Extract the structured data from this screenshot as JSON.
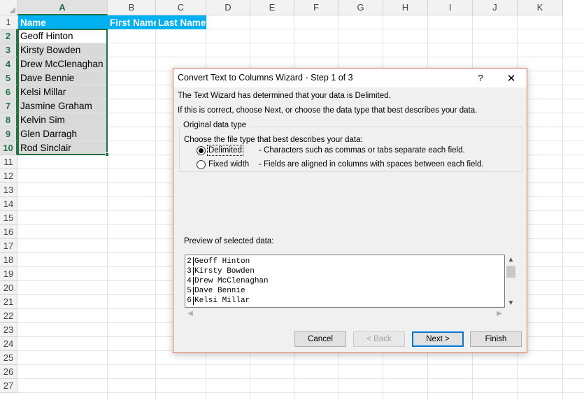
{
  "columns": [
    "A",
    "B",
    "C",
    "D",
    "E",
    "F",
    "G",
    "H",
    "I",
    "J",
    "K"
  ],
  "rows": [
    "1",
    "2",
    "3",
    "4",
    "5",
    "6",
    "7",
    "8",
    "9",
    "10",
    "11",
    "12",
    "13",
    "14",
    "15",
    "16",
    "17",
    "18",
    "19",
    "20",
    "21",
    "22",
    "23",
    "24",
    "25",
    "26",
    "27"
  ],
  "header_cells": {
    "a1": "Name",
    "b1": "First Name",
    "c1": "Last Name"
  },
  "names": [
    "Geoff Hinton",
    "Kirsty Bowden",
    "Drew McClenaghan",
    "Dave Bennie",
    "Kelsi Millar",
    "Jasmine Graham",
    "Kelvin Sim",
    "Glen Darragh",
    "Rod Sinclair"
  ],
  "colors": {
    "header_fill": "#00b0f0",
    "selection_border": "#217346",
    "selected_fill": "#d9d9d9"
  },
  "dialog": {
    "title": "Convert Text to Columns Wizard - Step 1 of 3",
    "help_icon": "?",
    "close_icon": "✕",
    "intro_line1": "The Text Wizard has determined that your data is Delimited.",
    "intro_line2": "If this is correct, choose Next, or choose the data type that best describes your data.",
    "group_label": "Original data type",
    "choose_text": "Choose the file type that best describes your data:",
    "options": [
      {
        "label": "Delimited",
        "description": "- Characters such as commas or tabs separate each field.",
        "checked": true
      },
      {
        "label": "Fixed width",
        "description": "- Fields are aligned in columns with spaces between each field.",
        "checked": false
      }
    ],
    "preview_label": "Preview of selected data:",
    "preview_rows": [
      {
        "num": "2",
        "text": "Geoff Hinton"
      },
      {
        "num": "3",
        "text": "Kirsty Bowden"
      },
      {
        "num": "4",
        "text": "Drew McClenaghan"
      },
      {
        "num": "5",
        "text": "Dave Bennie"
      },
      {
        "num": "6",
        "text": "Kelsi Millar"
      }
    ],
    "buttons": {
      "cancel": "Cancel",
      "back": "< Back",
      "next": "Next >",
      "finish": "Finish"
    }
  }
}
